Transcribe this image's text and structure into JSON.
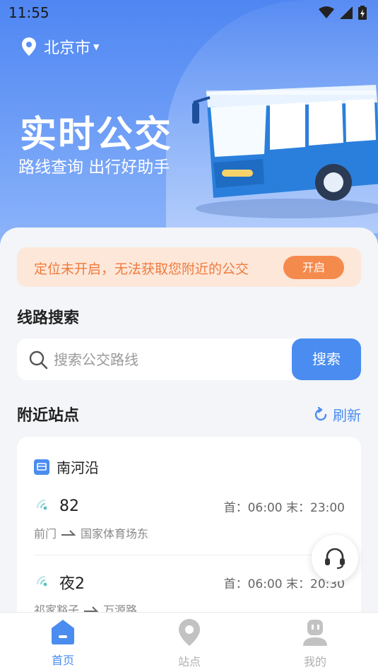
{
  "status_bar": {
    "time": "11:55"
  },
  "header": {
    "city": "北京市",
    "title": "实时公交",
    "subtitle": "路线查询 出行好助手"
  },
  "notice": {
    "text": "定位未开启，无法获取您附近的公交",
    "button": "开启"
  },
  "search": {
    "section_title": "线路搜索",
    "placeholder": "搜索公交路线",
    "button": "搜索"
  },
  "nearby": {
    "section_title": "附近站点",
    "refresh_label": "刷新",
    "station": {
      "name": "南河沿"
    },
    "routes": [
      {
        "name": "82",
        "time": "首：06:00  末：23:00",
        "from": "前门",
        "to": "国家体育场东"
      },
      {
        "name": "夜2",
        "time": "首：06:00  末：20:30",
        "from": "祁家豁子",
        "to": "万源路"
      }
    ]
  },
  "tabbar": {
    "items": [
      {
        "label": "首页",
        "active": true
      },
      {
        "label": "站点",
        "active": false
      },
      {
        "label": "我的",
        "active": false
      }
    ],
    "active_color": "#4a8cf0",
    "inactive_color": "#b8b8b8"
  },
  "colors": {
    "accent": "#4a8cf0",
    "warning": "#f58a4d"
  }
}
